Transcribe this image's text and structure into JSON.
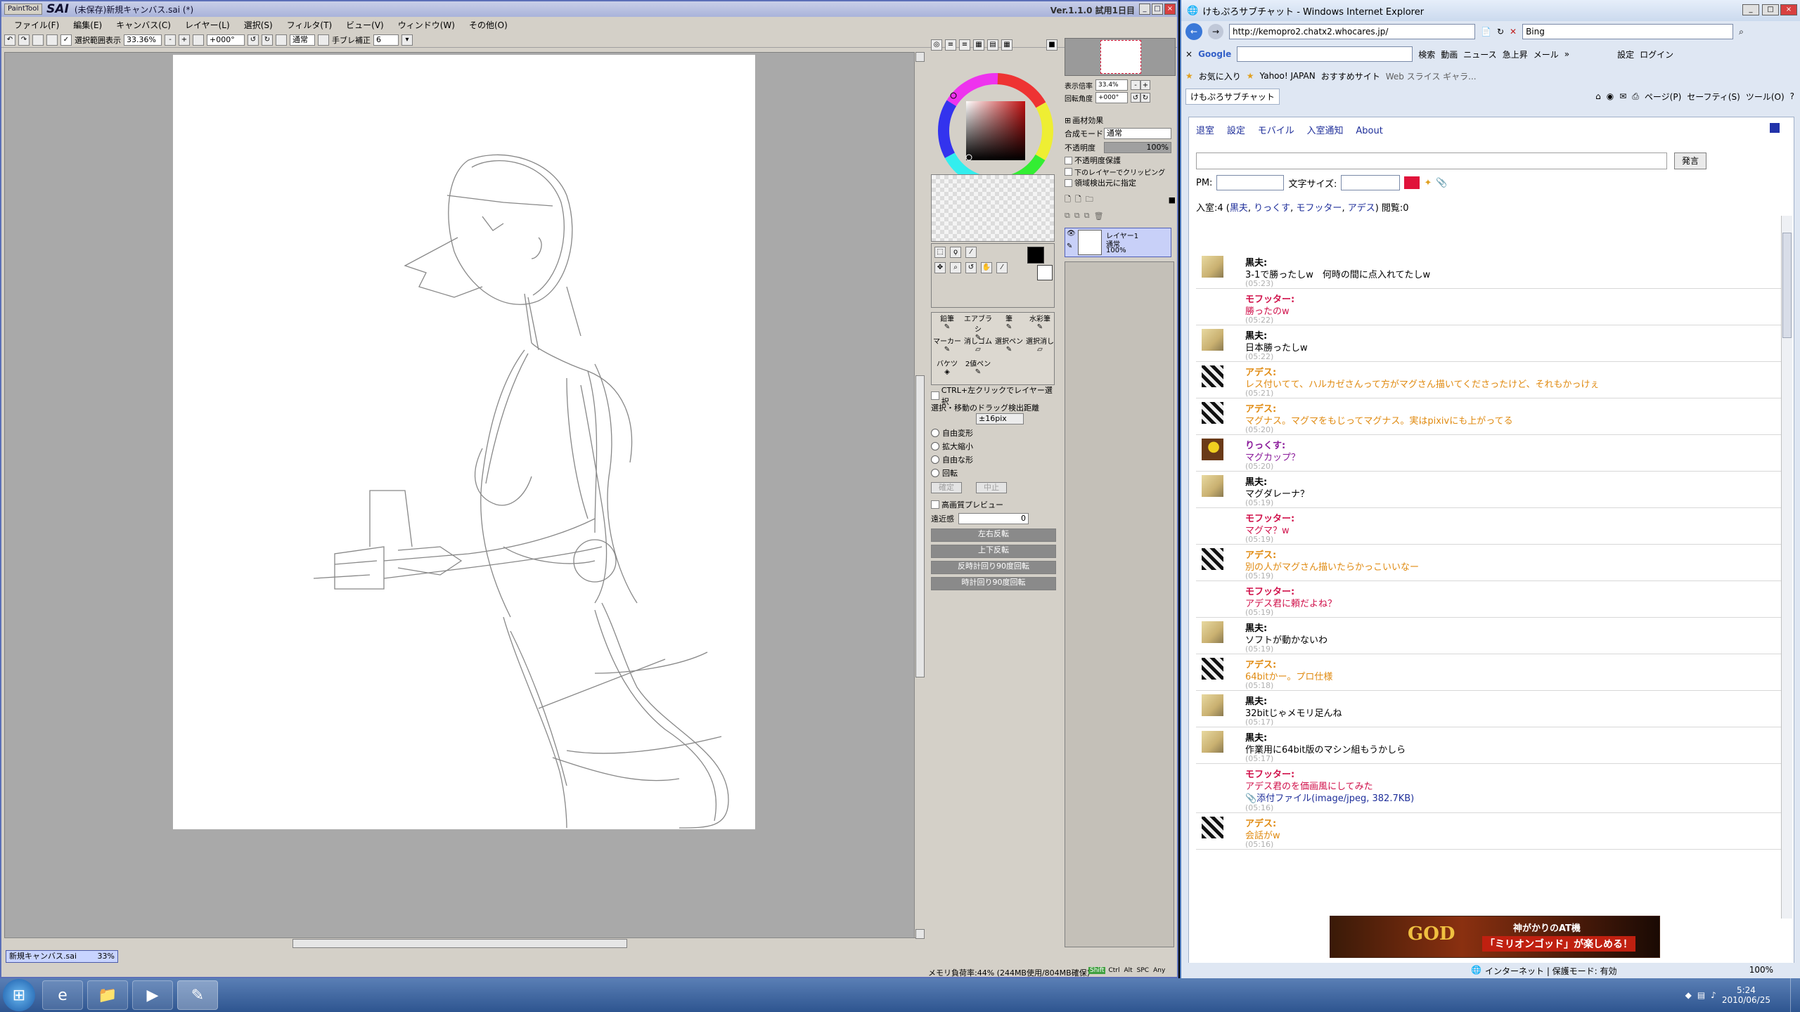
{
  "sai": {
    "logo_text": "PaintTool",
    "app_name": "SAI",
    "doc_title": "(未保存)新規キャンバス.sai (*)",
    "version": "Ver.1.1.0 試用1日目",
    "menu": [
      "ファイル(F)",
      "編集(E)",
      "キャンバス(C)",
      "レイヤー(L)",
      "選択(S)",
      "フィルタ(T)",
      "ビュー(V)",
      "ウィンドウ(W)",
      "その他(O)"
    ],
    "toolbar": {
      "selection_display": "選択範囲表示",
      "zoom": "33.36%",
      "angle": "+000°",
      "mode": "通常",
      "stabilizer_label": "手ブレ補正",
      "stabilizer_value": "6"
    },
    "nav": {
      "zoom_label": "表示倍率",
      "zoom_value": "33.4%",
      "angle_label": "回転角度",
      "angle_value": "+000°"
    },
    "layer": {
      "effects_label": "画材効果",
      "blend_label": "合成モード",
      "blend_value": "通常",
      "opacity_label": "不透明度",
      "opacity_value": "100%",
      "preserve_opacity": "不透明度保護",
      "clipping": "下のレイヤーでクリッピング",
      "selection_source": "領域検出元に指定",
      "layer_name": "レイヤー1",
      "layer_mode": "通常",
      "layer_opacity": "100%"
    },
    "tools": [
      "鉛筆",
      "エアブラシ",
      "筆",
      "水彩筆",
      "マーカー",
      "消しゴム",
      "選択ペン",
      "選択消し",
      "バケツ",
      "2値ペン"
    ],
    "options": {
      "ctrl_click": "CTRL+左クリックでレイヤー選択",
      "drag_threshold_label": "選択・移動のドラッグ検出距離",
      "drag_threshold_value": "±16pix",
      "radio": [
        "自由変形",
        "拡大縮小",
        "自由な形",
        "回転"
      ],
      "confirm": "確定",
      "cancel": "中止",
      "hq_preview": "高画質プレビュー",
      "perspective_label": "遠近感",
      "perspective_value": "0",
      "buttons": [
        "左右反転",
        "上下反転",
        "反時計回り90度回転",
        "時計回り90度回転"
      ]
    },
    "doc_tab": "新規キャンバス.sai",
    "doc_tab_zoom": "33%",
    "status": "メモリ負荷率:44% (244MB使用/804MB確保)",
    "status_keys": [
      "Shift",
      "Ctrl",
      "Alt",
      "SPC",
      "Any"
    ],
    "colors": {
      "title_bg": "#b7c0e4",
      "primary": "#000000",
      "secondary": "#ffffff",
      "hue": "#c01010"
    }
  },
  "ie": {
    "title": "けもぷろサブチャット - Windows Internet Explorer",
    "url": "http://kemopro2.chatx2.whocares.jp/",
    "search_provider": "Bing",
    "google_label": "Google",
    "google_search": "検索",
    "google_items": [
      "動画",
      "ニュース",
      "急上昇",
      "メール"
    ],
    "settings": "設定",
    "login": "ログイン",
    "favorites": "お気に入り",
    "fav_items": [
      "Yahoo! JAPAN",
      "おすすめサイト",
      "Web スライス ギャラ..."
    ],
    "tab_title": "けもぷろサブチャット",
    "cmd_items": [
      "ページ(P)",
      "セーフティ(S)",
      "ツール(O)"
    ],
    "status_zone": "インターネット | 保護モード: 有効",
    "zoom": "100%",
    "colors": {
      "frame": "#4b78b8",
      "link": "#1f2f9a",
      "chat_color": "#e0123a"
    }
  },
  "chat": {
    "nav": [
      "退室",
      "設定",
      "モバイル",
      "入室通知",
      "About"
    ],
    "post_button": "発言",
    "pm_label": "PM:",
    "font_size_label": "文字サイズ:",
    "members_prefix": "入室:4 (",
    "members": [
      "黒夫",
      "りっくす",
      "モフッター",
      "アデス"
    ],
    "members_suffix": ") 閲覧:0",
    "messages": [
      {
        "name": "黒夫:",
        "text": "3-1で勝ったしw　何時の間に点入れてたしw",
        "time": "(05:23)",
        "color": "#000000",
        "avatar": "blonde"
      },
      {
        "name": "モフッター:",
        "text": "勝ったのw",
        "time": "(05:22)",
        "color": "#d0104a",
        "avatar": "none"
      },
      {
        "name": "黒夫:",
        "text": "日本勝ったしw",
        "time": "(05:22)",
        "color": "#000000",
        "avatar": "blonde"
      },
      {
        "name": "アデス:",
        "text": "レス付いてて、ハルカゼさんって方がマグさん描いてくださったけど、それもかっけぇ",
        "time": "(05:21)",
        "color": "#e08a10",
        "avatar": "zebra"
      },
      {
        "name": "アデス:",
        "text": "マグナス。マグマをもじってマグナス。実はpixivにも上がってる",
        "time": "(05:20)",
        "color": "#e08a10",
        "avatar": "zebra"
      },
      {
        "name": "りっくす:",
        "text": "マグカップ？",
        "time": "(05:20)",
        "color": "#8a1a9a",
        "avatar": "duck"
      },
      {
        "name": "黒夫:",
        "text": "マグダレーナ？",
        "time": "(05:19)",
        "color": "#000000",
        "avatar": "blonde"
      },
      {
        "name": "モフッター:",
        "text": "マグマ？w",
        "time": "(05:19)",
        "color": "#d0104a",
        "avatar": "none"
      },
      {
        "name": "アデス:",
        "text": "別の人がマグさん描いたらかっこいいなー",
        "time": "(05:19)",
        "color": "#e08a10",
        "avatar": "zebra"
      },
      {
        "name": "モフッター:",
        "text": "アデス君に頼だよね？",
        "time": "(05:19)",
        "color": "#d0104a",
        "avatar": "none"
      },
      {
        "name": "黒夫:",
        "text": "ソフトが動かないわ",
        "time": "(05:19)",
        "color": "#000000",
        "avatar": "blonde"
      },
      {
        "name": "アデス:",
        "text": "64bitかー。プロ仕様",
        "time": "(05:18)",
        "color": "#e08a10",
        "avatar": "zebra"
      },
      {
        "name": "黒夫:",
        "text": "32bitじゃメモリ足んね",
        "time": "(05:17)",
        "color": "#000000",
        "avatar": "blonde"
      },
      {
        "name": "黒夫:",
        "text": "作業用に64bit版のマシン組もうかしら",
        "time": "(05:17)",
        "color": "#000000",
        "avatar": "blonde"
      },
      {
        "name": "モフッター:",
        "text": "アデス君のを価画風にしてみた",
        "attachment": "📎添付ファイル(image/jpeg, 382.7KB)",
        "time": "(05:16)",
        "color": "#d0104a",
        "avatar": "none"
      },
      {
        "name": "アデス:",
        "text": "会話がw",
        "time": "(05:16)",
        "color": "#e08a10",
        "avatar": "zebra"
      }
    ],
    "ad_text": "神がかりのAT機",
    "ad_title": "「ミリオンゴッド」が楽しめる！",
    "ad_logo": "GOD"
  },
  "taskbar": {
    "time": "5:24",
    "date": "2010/06/25"
  }
}
